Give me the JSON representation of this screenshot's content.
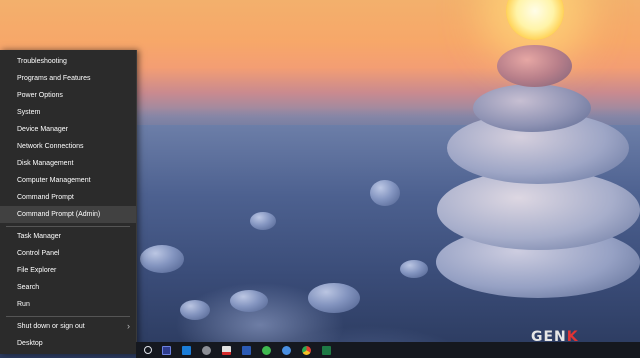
{
  "menu": {
    "items": [
      {
        "label": "Troubleshooting"
      },
      {
        "label": "Programs and Features"
      },
      {
        "label": "Power Options"
      },
      {
        "label": "System"
      },
      {
        "label": "Device Manager"
      },
      {
        "label": "Network Connections"
      },
      {
        "label": "Disk Management"
      },
      {
        "label": "Computer Management"
      },
      {
        "label": "Command Prompt"
      },
      {
        "label": "Command Prompt (Admin)",
        "highlighted": true
      },
      {
        "label": "Task Manager"
      },
      {
        "label": "Control Panel"
      },
      {
        "label": "File Explorer"
      },
      {
        "label": "Search"
      },
      {
        "label": "Run"
      },
      {
        "label": "Shut down or sign out",
        "has_submenu": true
      },
      {
        "label": "Desktop"
      }
    ],
    "submenu_glyph": "›"
  },
  "taskbar": {
    "icons": [
      "search-icon",
      "photoshop-icon",
      "blue-app-icon",
      "settings-icon",
      "mail-app-icon",
      "word-icon",
      "chat-app-icon",
      "messenger-icon",
      "chrome-icon",
      "excel-icon"
    ]
  },
  "watermark": {
    "text_main": "GEN",
    "text_accent": "K"
  },
  "colors": {
    "menu_background": "#2b2b2b",
    "menu_highlight": "#414141",
    "taskbar_background": "#15181f",
    "watermark_accent": "#e23434"
  }
}
